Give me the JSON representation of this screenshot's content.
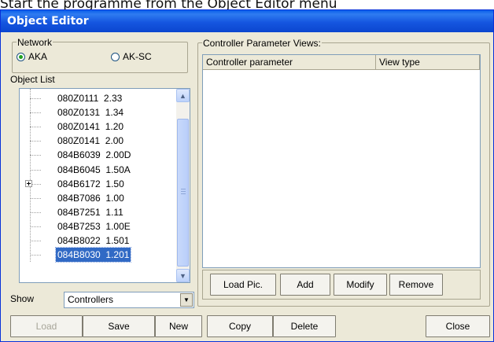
{
  "caption": "Start the programme from the Object Editor menu",
  "window": {
    "title": "Object Editor"
  },
  "network": {
    "label": "Network",
    "options": [
      {
        "label": "AKA",
        "selected": true
      },
      {
        "label": "AK-SC",
        "selected": false
      }
    ]
  },
  "object_list": {
    "label": "Object List",
    "items": [
      {
        "label": "080Z0111  2.33",
        "expandable": false,
        "selected": false
      },
      {
        "label": "080Z0131  1.34",
        "expandable": false,
        "selected": false
      },
      {
        "label": "080Z0141  1.20",
        "expandable": false,
        "selected": false
      },
      {
        "label": "080Z0141  2.00",
        "expandable": false,
        "selected": false
      },
      {
        "label": "084B6039  2.00D",
        "expandable": false,
        "selected": false
      },
      {
        "label": "084B6045  1.50A",
        "expandable": false,
        "selected": false
      },
      {
        "label": "084B6172  1.50",
        "expandable": true,
        "selected": false
      },
      {
        "label": "084B7086  1.00",
        "expandable": false,
        "selected": false
      },
      {
        "label": "084B7251  1.11",
        "expandable": false,
        "selected": false
      },
      {
        "label": "084B7253  1.00E",
        "expandable": false,
        "selected": false
      },
      {
        "label": "084B8022  1.501",
        "expandable": false,
        "selected": false
      },
      {
        "label": "084B8030  1.201",
        "expandable": false,
        "selected": true
      }
    ]
  },
  "show": {
    "label": "Show",
    "value": "Controllers"
  },
  "views": {
    "label": "Controller Parameter Views:",
    "columns": [
      "Controller parameter",
      "View type"
    ],
    "buttons": [
      "Load Pic.",
      "Add",
      "Modify",
      "Remove"
    ]
  },
  "bottom_buttons": {
    "load": "Load",
    "save": "Save",
    "new": "New",
    "copy": "Copy",
    "delete": "Delete",
    "close": "Close"
  },
  "colors": {
    "titlebar": "#0a5ee9",
    "selection": "#316ac5",
    "face": "#ece9d8"
  }
}
